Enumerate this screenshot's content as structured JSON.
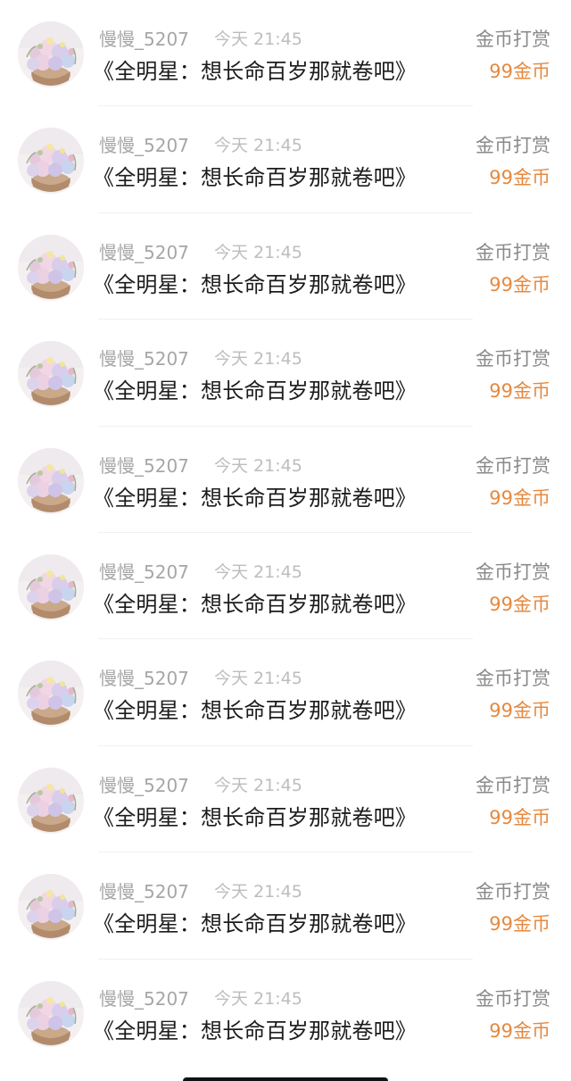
{
  "items": [
    {
      "username": "慢慢_5207",
      "time": "今天 21:45",
      "title": "《全明星：想长命百岁那就卷吧》",
      "type": "金币打赏",
      "amount": "99金币",
      "avatar": "flower-basket-avatar"
    },
    {
      "username": "慢慢_5207",
      "time": "今天 21:45",
      "title": "《全明星：想长命百岁那就卷吧》",
      "type": "金币打赏",
      "amount": "99金币",
      "avatar": "flower-basket-avatar"
    },
    {
      "username": "慢慢_5207",
      "time": "今天 21:45",
      "title": "《全明星：想长命百岁那就卷吧》",
      "type": "金币打赏",
      "amount": "99金币",
      "avatar": "flower-basket-avatar"
    },
    {
      "username": "慢慢_5207",
      "time": "今天 21:45",
      "title": "《全明星：想长命百岁那就卷吧》",
      "type": "金币打赏",
      "amount": "99金币",
      "avatar": "flower-basket-avatar"
    },
    {
      "username": "慢慢_5207",
      "time": "今天 21:45",
      "title": "《全明星：想长命百岁那就卷吧》",
      "type": "金币打赏",
      "amount": "99金币",
      "avatar": "flower-basket-avatar"
    },
    {
      "username": "慢慢_5207",
      "time": "今天 21:45",
      "title": "《全明星：想长命百岁那就卷吧》",
      "type": "金币打赏",
      "amount": "99金币",
      "avatar": "flower-basket-avatar"
    },
    {
      "username": "慢慢_5207",
      "time": "今天 21:45",
      "title": "《全明星：想长命百岁那就卷吧》",
      "type": "金币打赏",
      "amount": "99金币",
      "avatar": "flower-basket-avatar"
    },
    {
      "username": "慢慢_5207",
      "time": "今天 21:45",
      "title": "《全明星：想长命百岁那就卷吧》",
      "type": "金币打赏",
      "amount": "99金币",
      "avatar": "flower-basket-avatar"
    },
    {
      "username": "慢慢_5207",
      "time": "今天 21:45",
      "title": "《全明星：想长命百岁那就卷吧》",
      "type": "金币打赏",
      "amount": "99金币",
      "avatar": "flower-basket-avatar"
    },
    {
      "username": "慢慢_5207",
      "time": "今天 21:45",
      "title": "《全明星：想长命百岁那就卷吧》",
      "type": "金币打赏",
      "amount": "99金币",
      "avatar": "flower-basket-avatar"
    }
  ],
  "colors": {
    "username": "#a6a6a6",
    "time": "#bdbdbd",
    "title": "#1c1c1c",
    "type": "#8a8a8a",
    "amount": "#e5893f",
    "home_indicator": "#111111"
  }
}
